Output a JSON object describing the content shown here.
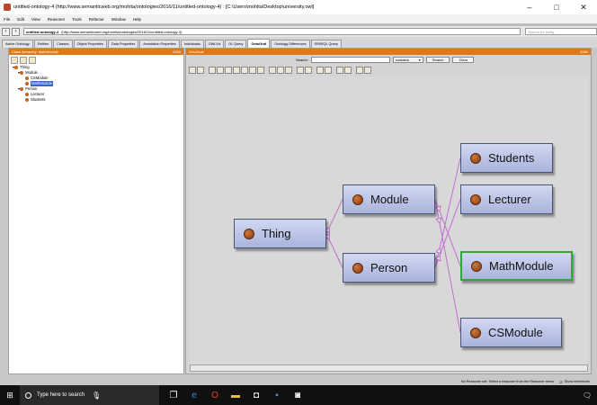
{
  "window": {
    "title": "untitled-ontology-4 (http://www.semanticweb.org/mohita/ontologies/2016/11/untitled-ontology-4) : [C:\\Users\\mohita\\Desktop\\university.owl]",
    "minimize": "–",
    "maximize": "□",
    "close": "✕"
  },
  "menu": [
    "File",
    "Edit",
    "View",
    "Reasoner",
    "Tools",
    "Refactor",
    "Window",
    "Help"
  ],
  "address": {
    "ontology": "untitled-ontology-4",
    "url": "(http://www.semanticweb.org/mohita/ontologies/2016/11/untitled-ontology-4)",
    "search_placeholder": "Search for entity"
  },
  "tabs": [
    {
      "label": "Active Ontology",
      "active": false
    },
    {
      "label": "Entities",
      "active": false
    },
    {
      "label": "Classes",
      "active": false
    },
    {
      "label": "Object Properties",
      "active": false
    },
    {
      "label": "Data Properties",
      "active": false
    },
    {
      "label": "Annotation Properties",
      "active": false
    },
    {
      "label": "Individuals",
      "active": false
    },
    {
      "label": "OWLViz",
      "active": false
    },
    {
      "label": "DL Query",
      "active": false
    },
    {
      "label": "OntoGraf",
      "active": true
    },
    {
      "label": "Ontology Differences",
      "active": false
    },
    {
      "label": "SPARQL Query",
      "active": false
    }
  ],
  "left_panel": {
    "header": "Class hierarchy: MathModule",
    "header_right": "2080",
    "tree": [
      {
        "label": "Thing",
        "level": 0,
        "selected": false
      },
      {
        "label": "Module",
        "level": 1,
        "selected": false
      },
      {
        "label": "CSModule",
        "level": 2,
        "selected": false
      },
      {
        "label": "MathModule",
        "level": 2,
        "selected": true
      },
      {
        "label": "Person",
        "level": 1,
        "selected": false
      },
      {
        "label": "Lecturer",
        "level": 2,
        "selected": false
      },
      {
        "label": "Students",
        "level": 2,
        "selected": false
      }
    ]
  },
  "right_panel": {
    "header": "OntoGraf",
    "header_right": "2080",
    "search_label": "Search:",
    "search_mode": "contains",
    "search_button": "Search",
    "clear_button": "Clear"
  },
  "graph": {
    "nodes": [
      {
        "id": "thing",
        "label": "Thing"
      },
      {
        "id": "module",
        "label": "Module"
      },
      {
        "id": "person",
        "label": "Person"
      },
      {
        "id": "students",
        "label": "Students"
      },
      {
        "id": "lecturer",
        "label": "Lecturer"
      },
      {
        "id": "mathmodule",
        "label": "MathModule",
        "selected": true
      },
      {
        "id": "csmodule",
        "label": "CSModule"
      }
    ],
    "edges": [
      [
        "thing",
        "module"
      ],
      [
        "thing",
        "person"
      ],
      [
        "module",
        "mathmodule"
      ],
      [
        "module",
        "csmodule"
      ],
      [
        "person",
        "students"
      ],
      [
        "person",
        "lecturer"
      ]
    ],
    "edge_color": "#c070d0",
    "node_fill": "#b0b9e0",
    "selected_border": "#2fa83a"
  },
  "status": {
    "text": "No Reasoner set. Select a reasoner from the Reasoner menu",
    "show_inferences": "Show Inferences"
  },
  "taskbar": {
    "search_placeholder": "Type here to search"
  }
}
